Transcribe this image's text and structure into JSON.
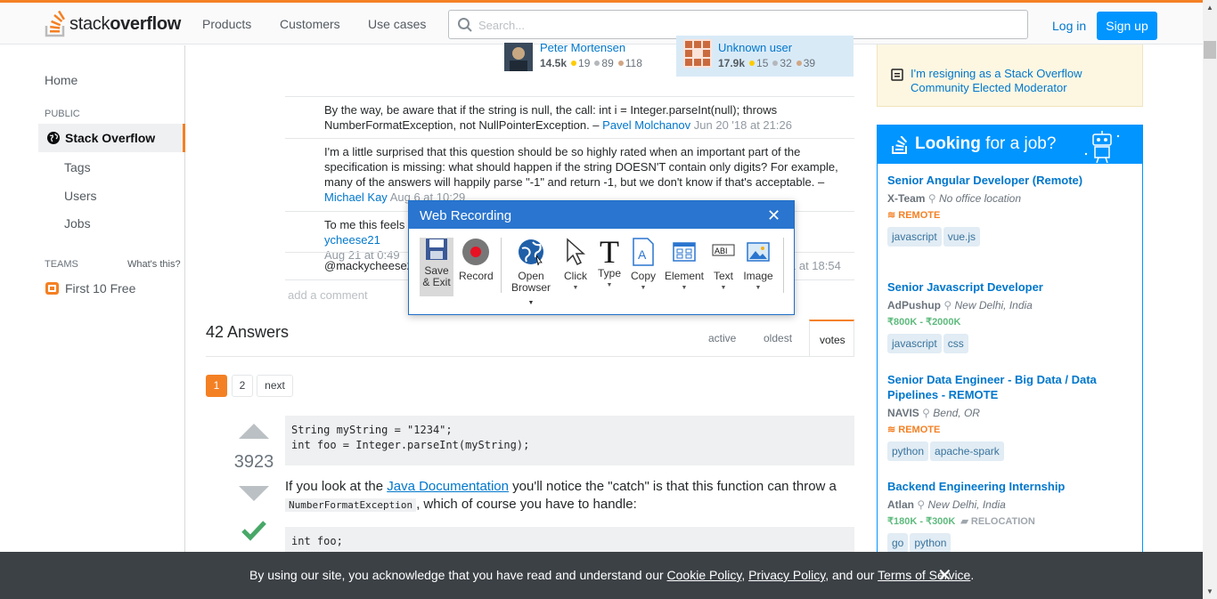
{
  "header": {
    "logo_text_light": "stack",
    "logo_text_bold": "overflow",
    "nav": [
      "Products",
      "Customers",
      "Use cases"
    ],
    "search_placeholder": "Search...",
    "login_label": "Log in",
    "signup_label": "Sign up"
  },
  "sidebar": {
    "home": "Home",
    "public_label": "PUBLIC",
    "stackoverflow": "Stack Overflow",
    "tags": "Tags",
    "users": "Users",
    "jobs": "Jobs",
    "teams_label": "TEAMS",
    "whats_this": "What's this?",
    "first_free": "First 10 Free"
  },
  "post_users": [
    {
      "name": "Peter Mortensen",
      "rep": "14.5k",
      "gold": "19",
      "silver": "89",
      "bronze": "118"
    },
    {
      "name": "Unknown user",
      "rep": "17.9k",
      "gold": "15",
      "silver": "32",
      "bronze": "39"
    }
  ],
  "comments": [
    {
      "text": "By the way, be aware that if the string is null, the call: int i = Integer.parseInt(null); throws NumberFormatException, not NullPointerException. – ",
      "user": "Pavel Molchanov",
      "date": "Jun 20 '18 at 21:26"
    },
    {
      "text": "I'm a little surprised that this question should be so highly rated when an important part of the specification is missing: what should happen if the string DOESN'T contain only digits? For example, many of the answers will happily parse \"-1\" and return -1, but we don't know if that's acceptable. – ",
      "user": "Michael Kay",
      "date": "Aug 6 at 10:29"
    },
    {
      "text": "To me this feels ",
      "user": "ycheese21",
      "date": "Aug 21 at 0:49"
    },
    {
      "text": "@mackycheese2",
      "user": "",
      "date": "1 at 18:54"
    }
  ],
  "add_comment": "add a comment",
  "answers": {
    "heading": "42 Answers",
    "tabs": [
      "active",
      "oldest",
      "votes"
    ],
    "pager": [
      "1",
      "2",
      "next"
    ],
    "votes": "3923",
    "code1": "String myString = \"1234\";\nint foo = Integer.parseInt(myString);",
    "text_before": "If you look at the ",
    "link": "Java Documentation",
    "text_after": " you'll notice the \"catch\" is that this function can throw a ",
    "inline_code": "NumberFormatException",
    "text_end": ", which of course you have to handle:",
    "code2": "int foo;"
  },
  "notice": {
    "link": "I'm resigning as a Stack Overflow Community Elected Moderator"
  },
  "jobs": {
    "title_bold": "Looking",
    "title_rest": " for a job?",
    "listings": [
      {
        "title": "Senior Angular Developer (Remote)",
        "company": "X-Team",
        "location": "No office location",
        "remote": "REMOTE",
        "salary": "",
        "relocation": "",
        "tags": [
          "javascript",
          "vue.js"
        ]
      },
      {
        "title": "Senior Javascript Developer",
        "company": "AdPushup",
        "location": "New Delhi, India",
        "remote": "",
        "salary": "₹800K - ₹2000K",
        "relocation": "",
        "tags": [
          "javascript",
          "css"
        ]
      },
      {
        "title": "Senior Data Engineer - Big Data / Data Pipelines - REMOTE",
        "company": "NAVIS",
        "location": "Bend, OR",
        "remote": "REMOTE",
        "salary": "",
        "relocation": "",
        "tags": [
          "python",
          "apache-spark"
        ]
      },
      {
        "title": "Backend Engineering Internship",
        "company": "Atlan",
        "location": "New Delhi, India",
        "remote": "",
        "salary": "₹180K - ₹300K",
        "relocation": "RELOCATION",
        "tags": [
          "go",
          "python"
        ]
      }
    ]
  },
  "recorder": {
    "title": "Web Recording",
    "tools": [
      {
        "label1": "Save",
        "label2": "& Exit"
      },
      {
        "label1": "Record",
        "label2": ""
      },
      {
        "label1": "Open",
        "label2": "Browser"
      },
      {
        "label1": "Click",
        "label2": ""
      },
      {
        "label1": "Type",
        "label2": ""
      },
      {
        "label1": "Copy",
        "label2": ""
      },
      {
        "label1": "Element",
        "label2": ""
      },
      {
        "label1": "Text",
        "label2": ""
      },
      {
        "label1": "Image",
        "label2": ""
      }
    ]
  },
  "cookie": {
    "text1": "By using our site, you acknowledge that you have read and understand our ",
    "cookie_policy": "Cookie Policy",
    "sep1": ", ",
    "privacy_policy": "Privacy Policy",
    "sep2": ", and our ",
    "terms": "Terms of Service",
    "end": "."
  },
  "colors": {
    "accent": "#f48024",
    "link": "#0077cc",
    "primary": "#0095ff"
  }
}
